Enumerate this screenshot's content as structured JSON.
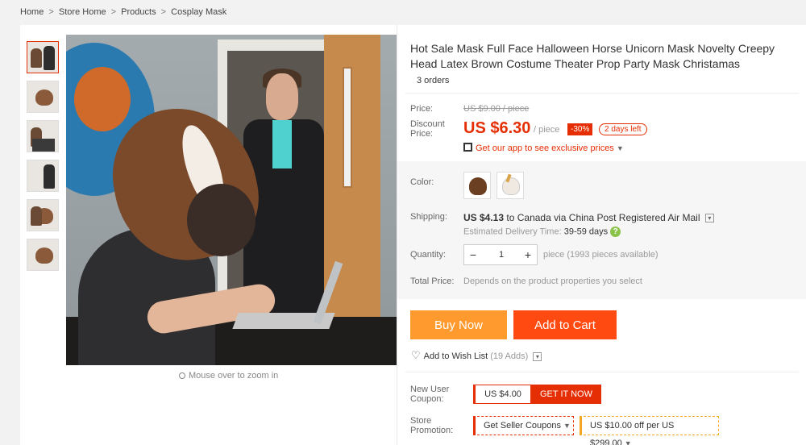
{
  "breadcrumb": {
    "items": [
      "Home",
      "Store Home",
      "Products",
      "Cosplay Mask"
    ],
    "separator": ">"
  },
  "gallery": {
    "zoom_hint": "Mouse over to zoom in",
    "thumbnail_count": 6
  },
  "product": {
    "title": "Hot Sale Mask Full Face Halloween Horse Unicorn Mask Novelty Creepy Head Latex Brown Costume Theater Prop Party Mask Christamas",
    "orders": "3 orders",
    "price_label": "Price:",
    "original_price": "US $9.00 / piece",
    "discount_price_label": "Discount Price:",
    "discount_price": "US $6.30",
    "price_unit": "/ piece",
    "discount_badge": "-30%",
    "days_left": "2 days left",
    "app_promo": "Get our app to see exclusive prices"
  },
  "options": {
    "color_label": "Color:",
    "colors": [
      "brown-horse",
      "white-unicorn"
    ],
    "shipping_label": "Shipping:",
    "shipping_cost": "US $4.13",
    "shipping_text": "to Canada via China Post Registered Air Mail",
    "delivery_label": "Estimated Delivery Time:",
    "delivery_days": "39-59 days",
    "quantity_label": "Quantity:",
    "quantity_value": "1",
    "quantity_note": "piece (1993 pieces available)",
    "total_label": "Total Price:",
    "total_note": "Depends on the product properties you select"
  },
  "actions": {
    "buy_now": "Buy Now",
    "add_to_cart": "Add to Cart",
    "wishlist": "Add to Wish List",
    "wishlist_count": "(19 Adds)"
  },
  "coupons": {
    "new_user_label": "New User Coupon:",
    "new_user_amount": "US $4.00",
    "get_it_now": "GET IT NOW",
    "store_promo_label": "Store Promotion:",
    "seller_coupons": "Get Seller Coupons",
    "promo_amount": "US $10.00",
    "promo_text": "off per",
    "promo_threshold": "US $299.00"
  },
  "colors": {
    "accent": "#e62e04",
    "buy_now": "#ff9a2e",
    "add_to_cart": "#ff4b12"
  }
}
